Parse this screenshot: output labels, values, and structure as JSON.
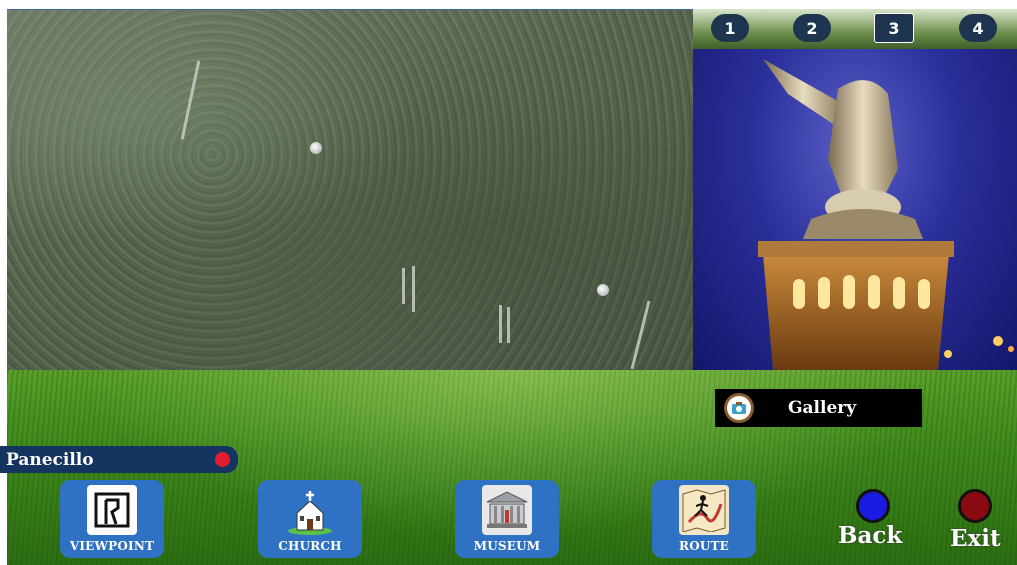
{
  "photo_tabs": [
    "1",
    "2",
    "3",
    "4"
  ],
  "gallery": {
    "label": "Gallery"
  },
  "location": {
    "name": "Panecillo"
  },
  "nav": {
    "viewpoint": "VIEWPOINT",
    "church": "CHURCH",
    "museum": "MUSEUM",
    "route": "ROUTE"
  },
  "controls": {
    "back": "Back",
    "exit": "Exit"
  },
  "colors": {
    "tile_blue": "#2f72c3",
    "location_bar": "#163460",
    "back_button": "#1a1ae0",
    "exit_button": "#8a0a12",
    "location_dot": "#e21b2d"
  },
  "icons": {
    "viewpoint": "viewpoint-icon",
    "church": "church-icon",
    "museum": "museum-icon",
    "route": "route-icon",
    "gallery": "camera-icon"
  }
}
